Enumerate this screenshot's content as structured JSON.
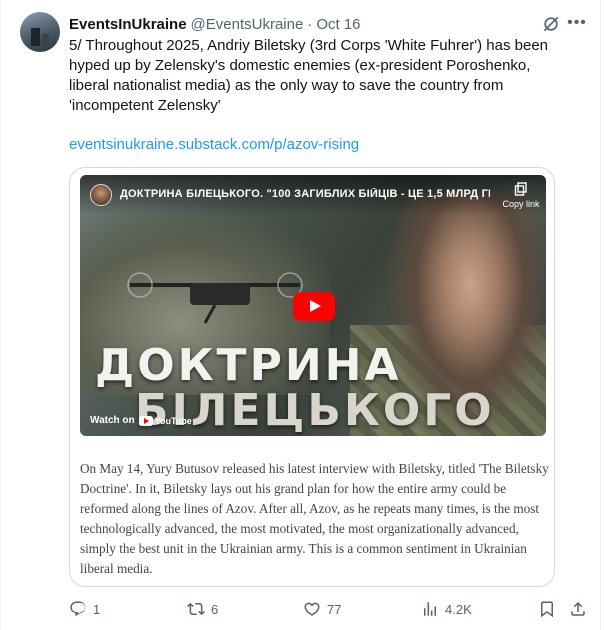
{
  "tweet": {
    "display_name": "EventsInUkraine",
    "handle": "@EventsUkraine",
    "separator": "·",
    "date": "Oct 16",
    "text": "5/ Throughout 2025, Andriy Biletsky (3rd Corps 'White Fuhrer') has been hyped up by Zelensky's domestic enemies (ex-president Poroshenko, liberal nationalist media) as the only way to save the country from 'incompetent Zelensky'",
    "link": "eventsinukraine.substack.com/p/azov-rising"
  },
  "card": {
    "video_title": "ДОКТРИНА БІЛЕЦЬКОГО. \"100 ЗАГИБЛИХ БІЙЦІВ - ЦЕ 1,5 МЛРД ГР...",
    "copy_link": "Copy link",
    "big_text_line1": "ДОКТРИНА",
    "big_text_line2": "БІЛЕЦЬКОГО",
    "watch_on": "Watch on",
    "youtube": "YouTube",
    "excerpt": "On May 14, Yury Butusov released his latest interview with Biletsky, titled 'The Biletsky Doctrine'. In it, Biletsky lays out his grand plan for how the entire army could be reformed along the lines of Azov. After all, Azov, as he repeats many times, is the most technologically advanced, the most motivated, the most organizationally advanced, simply the best unit in the Ukrainian army. This is a common sentiment in Ukrainian liberal media."
  },
  "actions": {
    "replies": "1",
    "reposts": "6",
    "likes": "77",
    "views": "4.2K"
  },
  "colors": {
    "link": "#1d9bf0",
    "secondary_text": "#536471",
    "play_button": "#ff0000"
  },
  "icons": {
    "grok": "grok-icon",
    "more": "more-icon",
    "reply": "reply-icon",
    "repost": "repost-icon",
    "like": "heart-icon",
    "views": "views-icon",
    "bookmark": "bookmark-icon",
    "share": "share-icon"
  }
}
